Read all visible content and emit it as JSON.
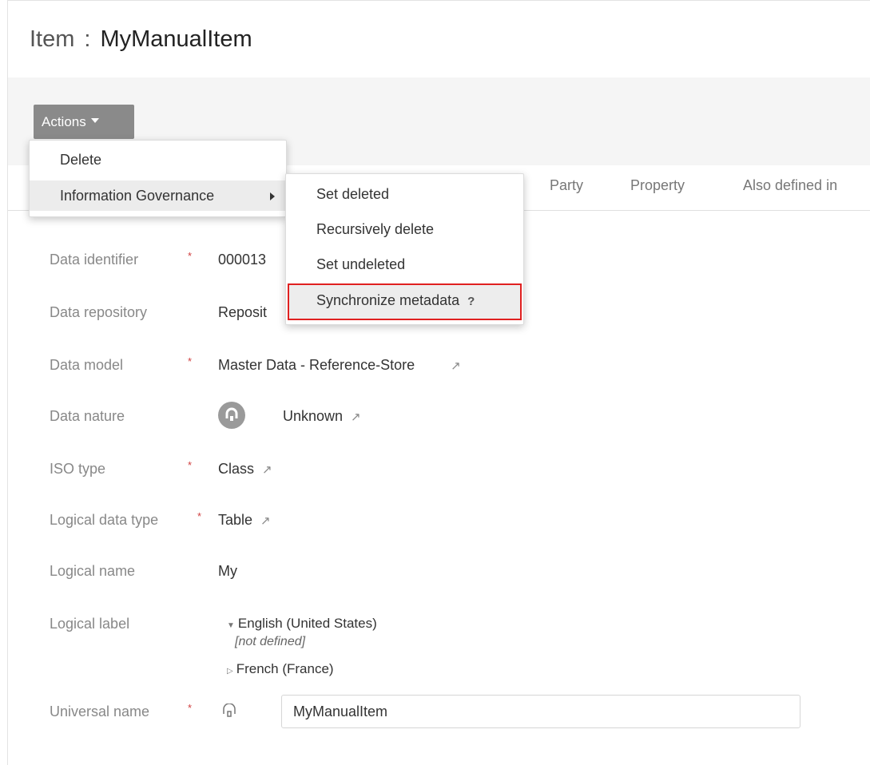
{
  "header": {
    "prefix": "Item",
    "separator": ":",
    "name": "MyManualItem"
  },
  "actions_label": "Actions",
  "tabs": [
    "Party",
    "Property",
    "Also defined in"
  ],
  "menu": {
    "items": [
      {
        "label": "Delete"
      },
      {
        "label": "Information Governance",
        "has_submenu": true,
        "highlighted": true
      }
    ],
    "submenu": [
      {
        "label": "Set deleted"
      },
      {
        "label": "Recursively delete"
      },
      {
        "label": "Set undeleted"
      },
      {
        "label": "Synchronize metadata",
        "help": "?",
        "highlighted": true,
        "highlight_color": "#e02020"
      }
    ]
  },
  "fields": {
    "data_identifier": {
      "label": "Data identifier",
      "required": true,
      "value": "000013"
    },
    "data_repository": {
      "label": "Data repository",
      "value": "Reposit"
    },
    "data_model": {
      "label": "Data model",
      "required": true,
      "value": "Master Data - Reference-Store"
    },
    "data_nature": {
      "label": "Data nature",
      "value": "Unknown"
    },
    "iso_type": {
      "label": "ISO type",
      "required": true,
      "value": "Class"
    },
    "logical_data_type": {
      "label": "Logical data type",
      "required": true,
      "value": "Table"
    },
    "logical_name": {
      "label": "Logical name",
      "value": "My"
    },
    "logical_label": {
      "label": "Logical label",
      "languages": [
        {
          "name": "English (United States)",
          "expanded": true,
          "value": "[not defined]"
        },
        {
          "name": "French (France)",
          "expanded": false
        }
      ]
    },
    "universal_name": {
      "label": "Universal name",
      "required": true,
      "value": "MyManualItem"
    }
  },
  "required_mark": "*",
  "icons": {
    "external_link": "external-link-icon",
    "data_nature": "unknown-nature-icon",
    "universal_name": "universal-name-icon"
  }
}
